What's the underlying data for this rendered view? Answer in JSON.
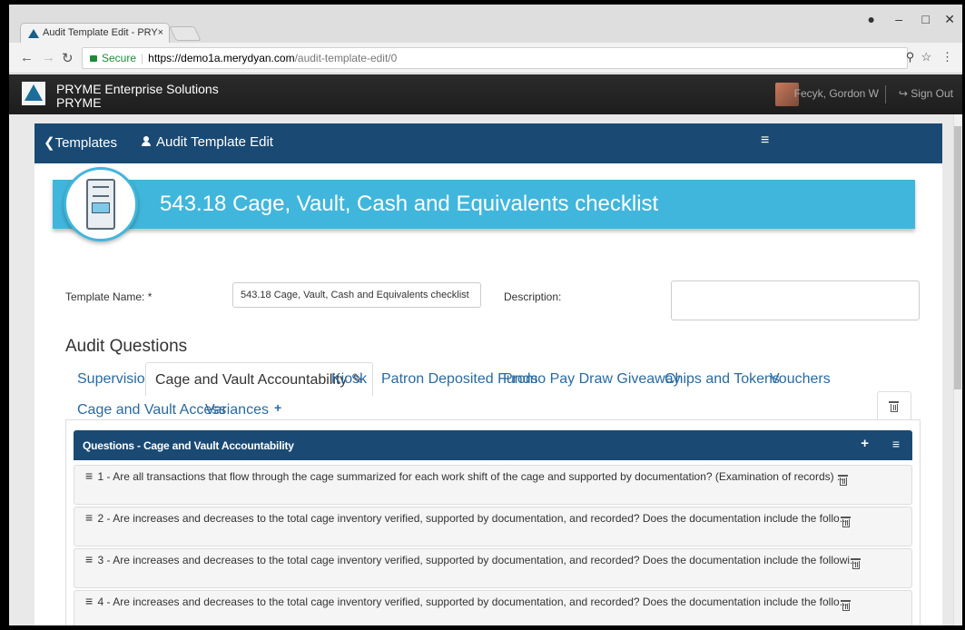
{
  "browser": {
    "tab_title": "Audit Template Edit - PRY",
    "tab_close": "×",
    "url_secure": "Secure",
    "url_host": "https://demo1a.merydyan.com",
    "url_path": "/audit-template-edit/0"
  },
  "header": {
    "brand_name": "PRYME Enterprise Solutions",
    "brand_sub": "PRYME",
    "user_name": "Fecyk, Gordon W",
    "sign_out": "Sign Out"
  },
  "nav": {
    "back_label": "Templates",
    "page_label": "Audit Template Edit"
  },
  "ribbon": {
    "title": "543.18 Cage, Vault, Cash and Equivalents checklist"
  },
  "form": {
    "template_name_label": "Template Name: *",
    "template_name_value": "543.18 Cage, Vault, Cash and Equivalents checklist",
    "description_label": "Description:"
  },
  "audit": {
    "section_title": "Audit Questions",
    "tabs": [
      "Supervision",
      "Cage and Vault Accountability",
      "Kiosk",
      "Patron Deposited Funds",
      "Promo Pay Draw Giveaway",
      "Chips and Tokens",
      "Vouchers",
      "Cage and Vault Access",
      "Variances"
    ],
    "questions_header": "Questions - Cage and Vault Accountability",
    "questions": [
      "1 - Are all transactions that flow through the cage summarized for each work shift of the cage and supported by documentation? (Examination of records) ...",
      "2 - Are increases and decreases to the total cage inventory verified, supported by documentation, and recorded? Does the documentation include the follo...",
      "3 - Are increases and decreases to the total cage inventory verified, supported by documentation, and recorded? Does the documentation include the followi...",
      "4 - Are increases and decreases to the total cage inventory verified, supported by documentation, and recorded? Does the documentation include the follo..."
    ]
  },
  "colors": {
    "nav_bar": "#1a4a74",
    "ribbon": "#41b6dc",
    "link": "#2a6aa0"
  }
}
